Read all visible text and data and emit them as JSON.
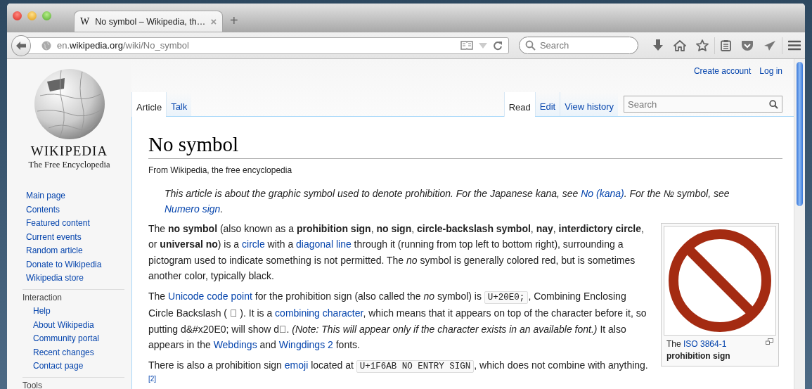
{
  "browser": {
    "tab": {
      "favicon": "W",
      "title": "No symbol – Wikipedia, th…"
    },
    "new_tab": "+",
    "url": {
      "prefix": "en.",
      "host": "wikipedia.org",
      "path": "/wiki/No_symbol"
    },
    "search": {
      "placeholder": "Search"
    }
  },
  "personal_links": [
    "Create account",
    "Log in"
  ],
  "logo": {
    "wordmark": "WIKIPEDIA",
    "tagline": "The Free Encyclopedia"
  },
  "sidebar": {
    "main": [
      "Main page",
      "Contents",
      "Featured content",
      "Current events",
      "Random article",
      "Donate to Wikipedia",
      "Wikipedia store"
    ],
    "sections": [
      {
        "heading": "Interaction",
        "items": [
          "Help",
          "About Wikipedia",
          "Community portal",
          "Recent changes",
          "Contact page"
        ]
      },
      {
        "heading": "Tools"
      }
    ]
  },
  "page_tabs": {
    "left": [
      {
        "label": "Article",
        "selected": true
      },
      {
        "label": "Talk",
        "selected": false
      }
    ],
    "right": [
      {
        "label": "Read",
        "selected": true
      },
      {
        "label": "Edit",
        "selected": false
      },
      {
        "label": "View history",
        "selected": false
      }
    ],
    "search": {
      "placeholder": "Search"
    }
  },
  "article": {
    "title": "No symbol",
    "tagline": "From Wikipedia, the free encyclopedia",
    "hatnote": [
      {
        "kind": "text",
        "text": "This article is about the graphic symbol used to denote prohibition. For the Japanese kana, see "
      },
      {
        "kind": "link",
        "text": "No (kana)"
      },
      {
        "kind": "text",
        "text": ". For the № symbol, see "
      },
      {
        "kind": "link",
        "text": "Numero sign"
      },
      {
        "kind": "text",
        "text": "."
      }
    ],
    "paragraphs": [
      [
        {
          "kind": "text",
          "text": "The **no symbol** (also known as a **prohibition sign**, **no sign**, **circle-backslash symbol**, **nay**, **interdictory circle**, or **universal no**) is a "
        },
        {
          "kind": "link",
          "text": "circle"
        },
        {
          "kind": "text",
          "text": " with a "
        },
        {
          "kind": "link",
          "text": "diagonal line"
        },
        {
          "kind": "text",
          "text": " through it (running from top left to bottom right), surrounding a pictogram used to indicate something is not permitted. The *no* symbol is generally colored red, but is sometimes another color, typically black."
        }
      ],
      [
        {
          "kind": "text",
          "text": "The "
        },
        {
          "kind": "link",
          "text": "Unicode code point"
        },
        {
          "kind": "text",
          "text": " for the prohibition sign (also called the *no* symbol) is "
        },
        {
          "kind": "code",
          "text": "U+20E0;"
        },
        {
          "kind": "text",
          "text": ", Combining Enclosing Circle Backslash (  ⃠ ). It is a "
        },
        {
          "kind": "link",
          "text": "combining character"
        },
        {
          "kind": "text",
          "text": ", which means that it appears on top of the character before it, so putting d&#x20E0; will show  d⃠.  *(Note: This will appear only if the character exists in an available font.)* It also appears in the "
        },
        {
          "kind": "link",
          "text": "Webdings"
        },
        {
          "kind": "text",
          "text": " and "
        },
        {
          "kind": "link",
          "text": "Wingdings 2"
        },
        {
          "kind": "text",
          "text": " fonts."
        }
      ],
      [
        {
          "kind": "text",
          "text": "There is also a prohibition sign "
        },
        {
          "kind": "link",
          "text": "emoji"
        },
        {
          "kind": "text",
          "text": " located at "
        },
        {
          "kind": "code",
          "text": "U+1F6AB NO ENTRY SIGN"
        },
        {
          "kind": "text",
          "text": ", which does not combine with anything."
        },
        {
          "kind": "ref",
          "text": "[2]"
        }
      ]
    ],
    "infobox": {
      "caption": [
        {
          "kind": "text",
          "text": "The "
        },
        {
          "kind": "link",
          "text": "ISO 3864-1"
        },
        {
          "kind": "text",
          "text": " **prohibition sign**"
        }
      ]
    }
  }
}
